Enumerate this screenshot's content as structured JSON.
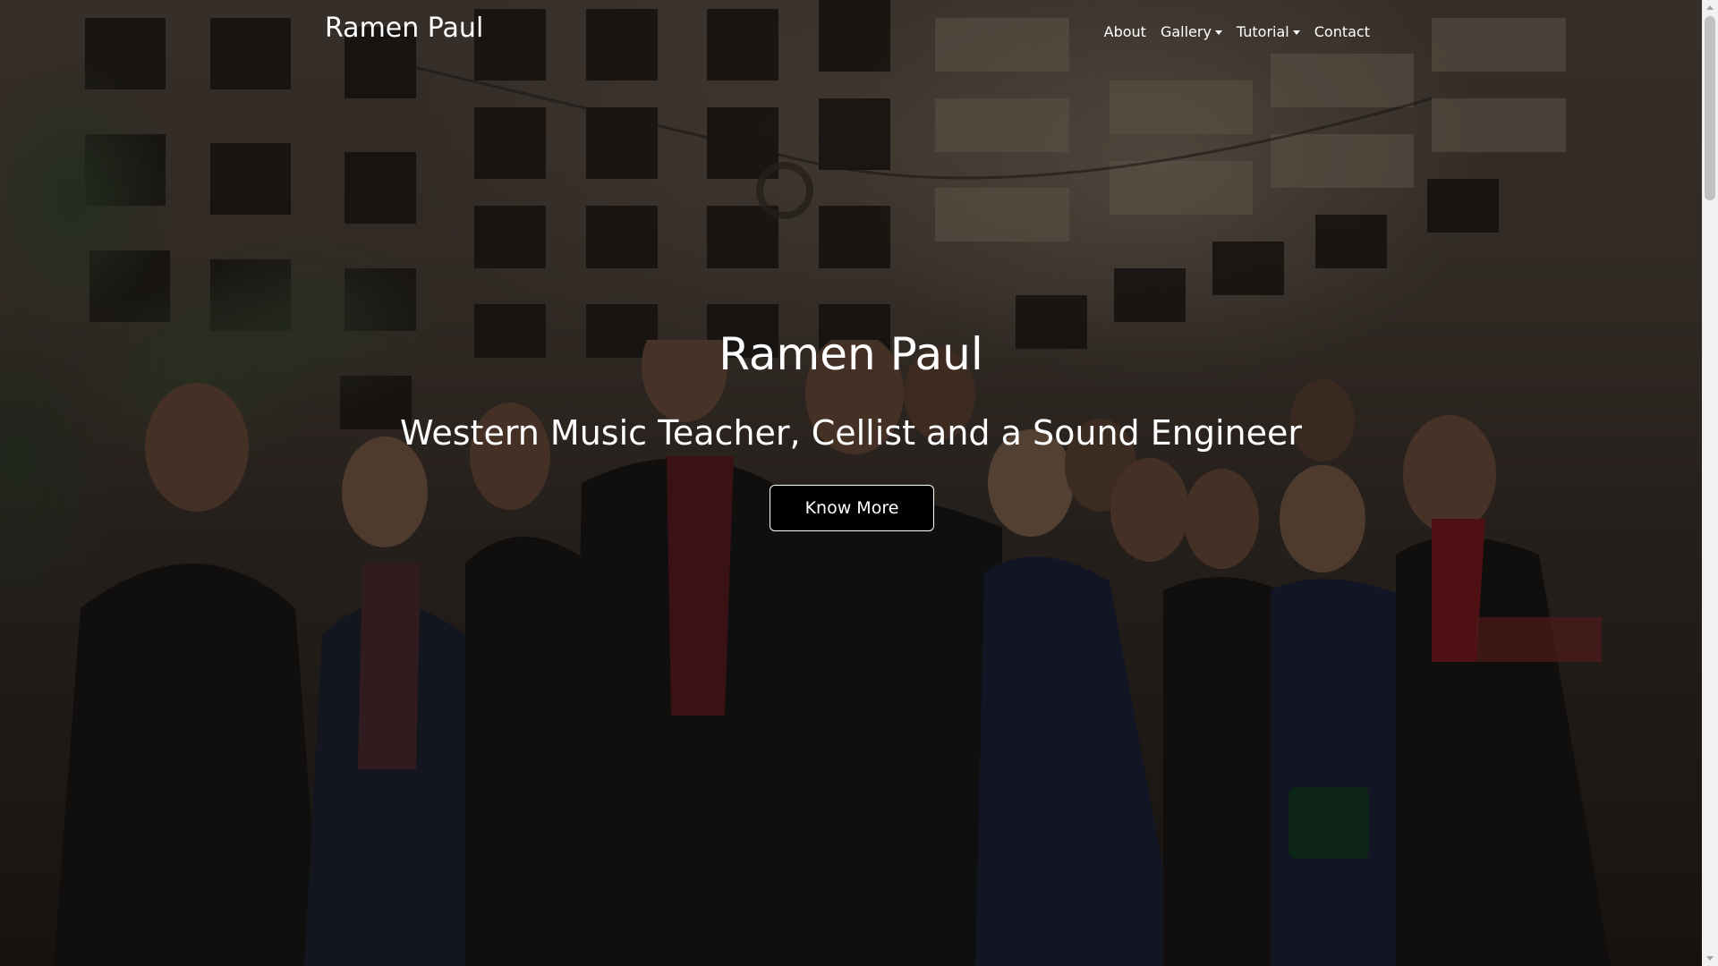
{
  "navbar": {
    "brand": "Ramen Paul",
    "links": [
      {
        "label": "About",
        "dropdown": false
      },
      {
        "label": "Gallery",
        "dropdown": true
      },
      {
        "label": "Tutorial",
        "dropdown": true
      },
      {
        "label": "Contact",
        "dropdown": false
      }
    ]
  },
  "hero": {
    "title": "Ramen Paul",
    "subtitle": "Western Music Teacher, Cellist and a Sound Engineer",
    "button_label": "Know More",
    "background_icon": "group-photo-background",
    "overlay_color": "#000000"
  },
  "colors": {
    "text": "#ffffff",
    "button_bg": "#000000",
    "button_border": "#ffffff",
    "scrollbar_track": "#f1f1f1",
    "scrollbar_thumb": "#c1c1c1"
  }
}
